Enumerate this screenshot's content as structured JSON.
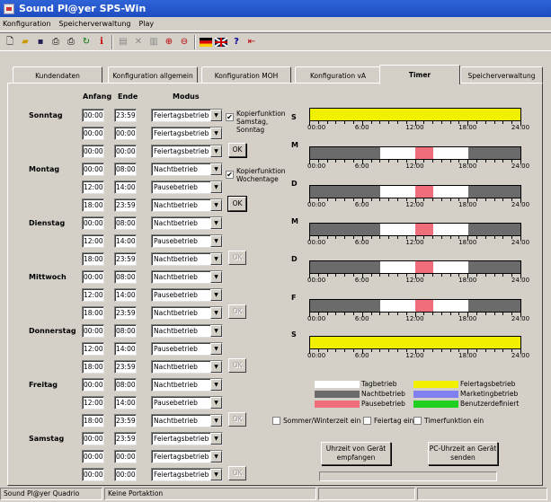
{
  "window": {
    "title": "Sound Pl@yer SPS-Win"
  },
  "menu": [
    "Konfiguration",
    "Speicherverwaltung",
    "Play"
  ],
  "toolbar": [
    "new-icon",
    "open-icon",
    "save-icon",
    "print-icon",
    "print-preview-icon",
    "refresh-icon",
    "info-icon",
    "grid-icon",
    "delete-icon",
    "table-icon",
    "zoom-in-icon",
    "zoom-out-icon",
    "flag-de-icon",
    "flag-gb-icon",
    "help-icon",
    "exit-icon"
  ],
  "tabs": [
    "Kundendaten",
    "Konfiguration allgemein",
    "Konfiguration MOH",
    "Konfiguration vA",
    "Timer",
    "Speicherverwaltung"
  ],
  "active_tab": "Timer",
  "headers": {
    "anfang": "Anfang",
    "ende": "Ende",
    "modus": "Modus"
  },
  "days": [
    {
      "name": "Sonntag",
      "rows": [
        {
          "a": "00:00",
          "e": "23:59",
          "m": "Feiertagsbetrieb"
        },
        {
          "a": "00:00",
          "e": "00:00",
          "m": "Feiertagsbetrieb"
        },
        {
          "a": "00:00",
          "e": "00:00",
          "m": "Feiertagsbetrieb"
        }
      ],
      "ok": "OK",
      "ok_enabled": true
    },
    {
      "name": "Montag",
      "rows": [
        {
          "a": "00:00",
          "e": "08:00",
          "m": "Nachtbetrieb"
        },
        {
          "a": "12:00",
          "e": "14:00",
          "m": "Pausebetrieb"
        },
        {
          "a": "18:00",
          "e": "23:59",
          "m": "Nachtbetrieb"
        }
      ],
      "ok": "OK",
      "ok_enabled": true
    },
    {
      "name": "Dienstag",
      "rows": [
        {
          "a": "00:00",
          "e": "08:00",
          "m": "Nachtbetrieb"
        },
        {
          "a": "12:00",
          "e": "14:00",
          "m": "Pausebetrieb"
        },
        {
          "a": "18:00",
          "e": "23:59",
          "m": "Nachtbetrieb"
        }
      ],
      "ok": "OK",
      "ok_enabled": false
    },
    {
      "name": "Mittwoch",
      "rows": [
        {
          "a": "00:00",
          "e": "08:00",
          "m": "Nachtbetrieb"
        },
        {
          "a": "12:00",
          "e": "14:00",
          "m": "Pausebetrieb"
        },
        {
          "a": "18:00",
          "e": "23:59",
          "m": "Nachtbetrieb"
        }
      ],
      "ok": "OK",
      "ok_enabled": false
    },
    {
      "name": "Donnerstag",
      "rows": [
        {
          "a": "00:00",
          "e": "08:00",
          "m": "Nachtbetrieb"
        },
        {
          "a": "12:00",
          "e": "14:00",
          "m": "Pausebetrieb"
        },
        {
          "a": "18:00",
          "e": "23:59",
          "m": "Nachtbetrieb"
        }
      ],
      "ok": "OK",
      "ok_enabled": false
    },
    {
      "name": "Freitag",
      "rows": [
        {
          "a": "00:00",
          "e": "08:00",
          "m": "Nachtbetrieb"
        },
        {
          "a": "12:00",
          "e": "14:00",
          "m": "Pausebetrieb"
        },
        {
          "a": "18:00",
          "e": "23:59",
          "m": "Nachtbetrieb"
        }
      ],
      "ok": "OK",
      "ok_enabled": false
    },
    {
      "name": "Samstag",
      "rows": [
        {
          "a": "00:00",
          "e": "23:59",
          "m": "Feiertagsbetrieb"
        },
        {
          "a": "00:00",
          "e": "00:00",
          "m": "Feiertagsbetrieb"
        },
        {
          "a": "00:00",
          "e": "00:00",
          "m": "Feiertagsbetrieb"
        }
      ],
      "ok": "OK",
      "ok_enabled": false
    }
  ],
  "copy1": {
    "label": "Kopierfunktion Samstag, Sonntag",
    "checked": true
  },
  "copy2": {
    "label": "Kopierfunktion Wochentage",
    "checked": true
  },
  "timeline": {
    "ticks": [
      "00:00",
      "6:00",
      "12:00",
      "18:00",
      "24:00"
    ],
    "days": [
      {
        "letter": "S",
        "segments": [
          {
            "from": 0,
            "to": 24,
            "mode": "Feiertagsbetrieb"
          }
        ]
      },
      {
        "letter": "M",
        "segments": [
          {
            "from": 0,
            "to": 8,
            "mode": "Nachtbetrieb"
          },
          {
            "from": 8,
            "to": 12,
            "mode": "Tagbetrieb"
          },
          {
            "from": 12,
            "to": 14,
            "mode": "Pausebetrieb"
          },
          {
            "from": 14,
            "to": 18,
            "mode": "Tagbetrieb"
          },
          {
            "from": 18,
            "to": 24,
            "mode": "Nachtbetrieb"
          }
        ]
      },
      {
        "letter": "D",
        "segments": [
          {
            "from": 0,
            "to": 8,
            "mode": "Nachtbetrieb"
          },
          {
            "from": 8,
            "to": 12,
            "mode": "Tagbetrieb"
          },
          {
            "from": 12,
            "to": 14,
            "mode": "Pausebetrieb"
          },
          {
            "from": 14,
            "to": 18,
            "mode": "Tagbetrieb"
          },
          {
            "from": 18,
            "to": 24,
            "mode": "Nachtbetrieb"
          }
        ]
      },
      {
        "letter": "M",
        "segments": [
          {
            "from": 0,
            "to": 8,
            "mode": "Nachtbetrieb"
          },
          {
            "from": 8,
            "to": 12,
            "mode": "Tagbetrieb"
          },
          {
            "from": 12,
            "to": 14,
            "mode": "Pausebetrieb"
          },
          {
            "from": 14,
            "to": 18,
            "mode": "Tagbetrieb"
          },
          {
            "from": 18,
            "to": 24,
            "mode": "Nachtbetrieb"
          }
        ]
      },
      {
        "letter": "D",
        "segments": [
          {
            "from": 0,
            "to": 8,
            "mode": "Nachtbetrieb"
          },
          {
            "from": 8,
            "to": 12,
            "mode": "Tagbetrieb"
          },
          {
            "from": 12,
            "to": 14,
            "mode": "Pausebetrieb"
          },
          {
            "from": 14,
            "to": 18,
            "mode": "Tagbetrieb"
          },
          {
            "from": 18,
            "to": 24,
            "mode": "Nachtbetrieb"
          }
        ]
      },
      {
        "letter": "F",
        "segments": [
          {
            "from": 0,
            "to": 8,
            "mode": "Nachtbetrieb"
          },
          {
            "from": 8,
            "to": 12,
            "mode": "Tagbetrieb"
          },
          {
            "from": 12,
            "to": 14,
            "mode": "Pausebetrieb"
          },
          {
            "from": 14,
            "to": 18,
            "mode": "Tagbetrieb"
          },
          {
            "from": 18,
            "to": 24,
            "mode": "Nachtbetrieb"
          }
        ]
      },
      {
        "letter": "S",
        "segments": [
          {
            "from": 0,
            "to": 24,
            "mode": "Feiertagsbetrieb"
          }
        ]
      }
    ]
  },
  "colors": {
    "Tagbetrieb": "#ffffff",
    "Nachtbetrieb": "#6b6b6b",
    "Pausebetrieb": "#f06e7c",
    "Feiertagsbetrieb": "#f0f000",
    "Marketingbetrieb": "#8080f0",
    "Benutzerdefiniert": "#20d020"
  },
  "legend": [
    "Tagbetrieb",
    "Nachtbetrieb",
    "Pausebetrieb",
    "Feiertagsbetrieb",
    "Marketingbetrieb",
    "Benutzerdefiniert"
  ],
  "options": [
    {
      "label": "Sommer/Winterzeit ein",
      "checked": false
    },
    {
      "label": "Feiertag ein",
      "checked": false
    },
    {
      "label": "Timerfunktion ein",
      "checked": false
    }
  ],
  "buttons": {
    "get_time": "Uhrzeit von Gerät empfangen",
    "send_time": "PC-Uhrzeit an Gerät senden"
  },
  "status": [
    "Sound Pl@yer Quadrio",
    "Keine Portaktion",
    "",
    ""
  ]
}
